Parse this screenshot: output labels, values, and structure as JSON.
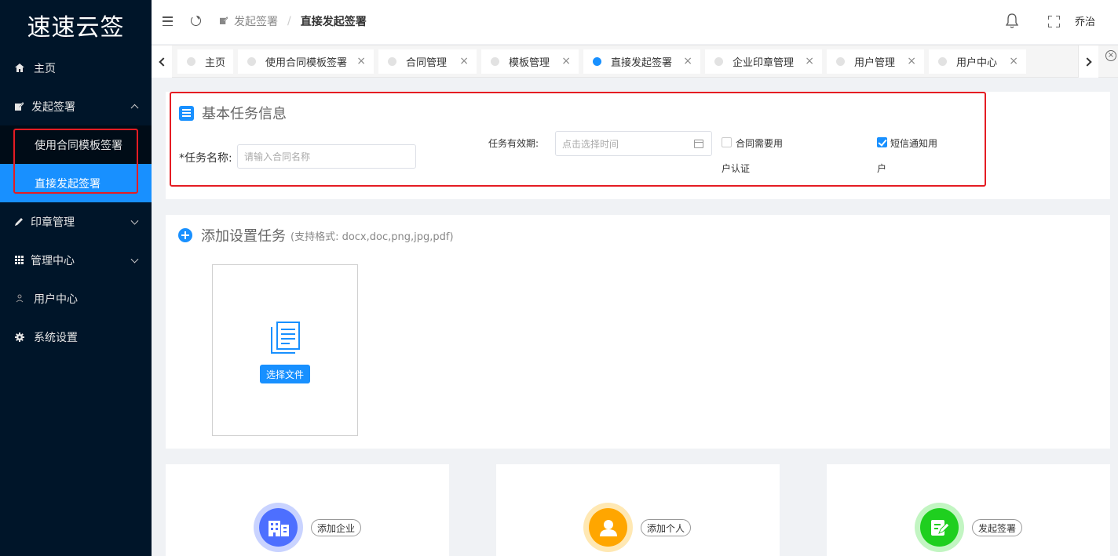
{
  "app": {
    "logo": "速速云签"
  },
  "sidebar": {
    "items": [
      {
        "label": "主页"
      },
      {
        "label": "发起签署"
      },
      {
        "label": "印章管理"
      },
      {
        "label": "管理中心"
      },
      {
        "label": "用户中心"
      },
      {
        "label": "系统设置"
      }
    ],
    "submenu": [
      {
        "label": "使用合同模板签署"
      },
      {
        "label": "直接发起签署"
      }
    ]
  },
  "header": {
    "breadcrumb": [
      "发起签署",
      "直接发起签署"
    ],
    "breadcrumb_sep": "/",
    "username": "乔治"
  },
  "tabs": [
    {
      "label": "主页"
    },
    {
      "label": "使用合同模板签署"
    },
    {
      "label": "合同管理"
    },
    {
      "label": "模板管理"
    },
    {
      "label": "直接发起签署"
    },
    {
      "label": "企业印章管理"
    },
    {
      "label": "用户管理"
    },
    {
      "label": "用户中心"
    }
  ],
  "tab_close": "×",
  "basic_info": {
    "title": "基本任务信息",
    "task_name_label": "*任务名称:",
    "task_name_placeholder": "请输入合同名称",
    "validity_label": "任务有效期:",
    "validity_placeholder": "点击选择时间",
    "auth_line1": "合同需要用",
    "auth_line2": "户认证",
    "sms_line1": "短信通知用",
    "sms_line2": "户",
    "auth_checked": false,
    "sms_checked": true
  },
  "add_task": {
    "title": "添加设置任务",
    "subtitle": "(支持格式: docx,doc,png,jpg,pdf)",
    "select_file": "选择文件"
  },
  "actions": [
    {
      "label": "添加企业",
      "color": "#4d6fff"
    },
    {
      "label": "添加个人",
      "color": "#ffa600"
    },
    {
      "label": "发起签署",
      "color": "#1fcf1f"
    }
  ]
}
